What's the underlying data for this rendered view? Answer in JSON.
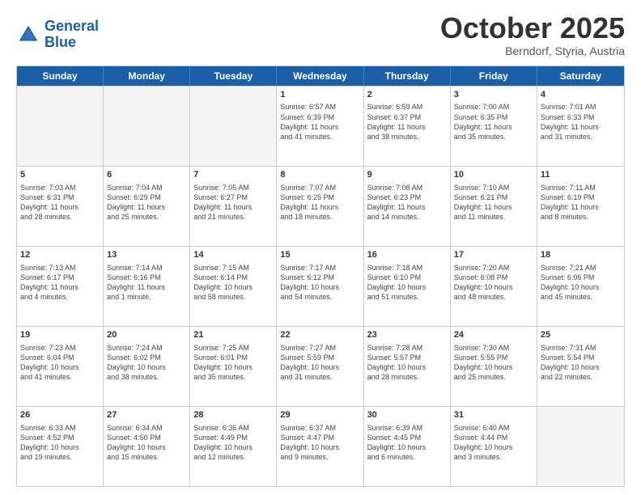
{
  "header": {
    "logo_line1": "General",
    "logo_line2": "Blue",
    "title": "October 2025",
    "subtitle": "Berndorf, Styria, Austria"
  },
  "days_of_week": [
    "Sunday",
    "Monday",
    "Tuesday",
    "Wednesday",
    "Thursday",
    "Friday",
    "Saturday"
  ],
  "weeks": [
    [
      {
        "day": null,
        "info": null
      },
      {
        "day": null,
        "info": null
      },
      {
        "day": null,
        "info": null
      },
      {
        "day": "1",
        "info": "Sunrise: 6:57 AM\nSunset: 6:39 PM\nDaylight: 11 hours\nand 41 minutes."
      },
      {
        "day": "2",
        "info": "Sunrise: 6:59 AM\nSunset: 6:37 PM\nDaylight: 11 hours\nand 38 minutes."
      },
      {
        "day": "3",
        "info": "Sunrise: 7:00 AM\nSunset: 6:35 PM\nDaylight: 11 hours\nand 35 minutes."
      },
      {
        "day": "4",
        "info": "Sunrise: 7:01 AM\nSunset: 6:33 PM\nDaylight: 11 hours\nand 31 minutes."
      }
    ],
    [
      {
        "day": "5",
        "info": "Sunrise: 7:03 AM\nSunset: 6:31 PM\nDaylight: 11 hours\nand 28 minutes."
      },
      {
        "day": "6",
        "info": "Sunrise: 7:04 AM\nSunset: 6:29 PM\nDaylight: 11 hours\nand 25 minutes."
      },
      {
        "day": "7",
        "info": "Sunrise: 7:05 AM\nSunset: 6:27 PM\nDaylight: 11 hours\nand 21 minutes."
      },
      {
        "day": "8",
        "info": "Sunrise: 7:07 AM\nSunset: 6:25 PM\nDaylight: 11 hours\nand 18 minutes."
      },
      {
        "day": "9",
        "info": "Sunrise: 7:08 AM\nSunset: 6:23 PM\nDaylight: 11 hours\nand 14 minutes."
      },
      {
        "day": "10",
        "info": "Sunrise: 7:10 AM\nSunset: 6:21 PM\nDaylight: 11 hours\nand 11 minutes."
      },
      {
        "day": "11",
        "info": "Sunrise: 7:11 AM\nSunset: 6:19 PM\nDaylight: 11 hours\nand 8 minutes."
      }
    ],
    [
      {
        "day": "12",
        "info": "Sunrise: 7:13 AM\nSunset: 6:17 PM\nDaylight: 11 hours\nand 4 minutes."
      },
      {
        "day": "13",
        "info": "Sunrise: 7:14 AM\nSunset: 6:16 PM\nDaylight: 11 hours\nand 1 minute."
      },
      {
        "day": "14",
        "info": "Sunrise: 7:15 AM\nSunset: 6:14 PM\nDaylight: 10 hours\nand 58 minutes."
      },
      {
        "day": "15",
        "info": "Sunrise: 7:17 AM\nSunset: 6:12 PM\nDaylight: 10 hours\nand 54 minutes."
      },
      {
        "day": "16",
        "info": "Sunrise: 7:18 AM\nSunset: 6:10 PM\nDaylight: 10 hours\nand 51 minutes."
      },
      {
        "day": "17",
        "info": "Sunrise: 7:20 AM\nSunset: 6:08 PM\nDaylight: 10 hours\nand 48 minutes."
      },
      {
        "day": "18",
        "info": "Sunrise: 7:21 AM\nSunset: 6:06 PM\nDaylight: 10 hours\nand 45 minutes."
      }
    ],
    [
      {
        "day": "19",
        "info": "Sunrise: 7:23 AM\nSunset: 6:04 PM\nDaylight: 10 hours\nand 41 minutes."
      },
      {
        "day": "20",
        "info": "Sunrise: 7:24 AM\nSunset: 6:02 PM\nDaylight: 10 hours\nand 38 minutes."
      },
      {
        "day": "21",
        "info": "Sunrise: 7:25 AM\nSunset: 6:01 PM\nDaylight: 10 hours\nand 35 minutes."
      },
      {
        "day": "22",
        "info": "Sunrise: 7:27 AM\nSunset: 5:59 PM\nDaylight: 10 hours\nand 31 minutes."
      },
      {
        "day": "23",
        "info": "Sunrise: 7:28 AM\nSunset: 5:57 PM\nDaylight: 10 hours\nand 28 minutes."
      },
      {
        "day": "24",
        "info": "Sunrise: 7:30 AM\nSunset: 5:55 PM\nDaylight: 10 hours\nand 25 minutes."
      },
      {
        "day": "25",
        "info": "Sunrise: 7:31 AM\nSunset: 5:54 PM\nDaylight: 10 hours\nand 22 minutes."
      }
    ],
    [
      {
        "day": "26",
        "info": "Sunrise: 6:33 AM\nSunset: 4:52 PM\nDaylight: 10 hours\nand 19 minutes."
      },
      {
        "day": "27",
        "info": "Sunrise: 6:34 AM\nSunset: 4:50 PM\nDaylight: 10 hours\nand 15 minutes."
      },
      {
        "day": "28",
        "info": "Sunrise: 6:36 AM\nSunset: 4:49 PM\nDaylight: 10 hours\nand 12 minutes."
      },
      {
        "day": "29",
        "info": "Sunrise: 6:37 AM\nSunset: 4:47 PM\nDaylight: 10 hours\nand 9 minutes."
      },
      {
        "day": "30",
        "info": "Sunrise: 6:39 AM\nSunset: 4:45 PM\nDaylight: 10 hours\nand 6 minutes."
      },
      {
        "day": "31",
        "info": "Sunrise: 6:40 AM\nSunset: 4:44 PM\nDaylight: 10 hours\nand 3 minutes."
      },
      {
        "day": null,
        "info": null
      }
    ]
  ]
}
